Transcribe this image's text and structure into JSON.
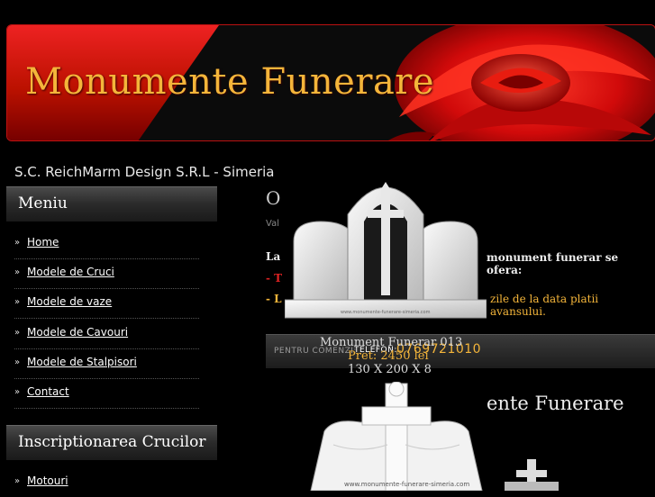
{
  "header": {
    "title": "Monumente Funerare"
  },
  "subtitle": "S.C. ReichMarm Design S.R.L - Simeria",
  "sidebar": {
    "menu_title": "Meniu",
    "items": [
      {
        "label": "Home"
      },
      {
        "label": "Modele de Cruci"
      },
      {
        "label": "Modele de vaze"
      },
      {
        "label": "Modele de Cavouri"
      },
      {
        "label": "Modele de Stalpisori"
      },
      {
        "label": "Contact"
      }
    ],
    "section2_title": "Inscriptionarea Crucilor",
    "section2_items": [
      {
        "label": "Motouri"
      }
    ]
  },
  "main": {
    "title_fragment": "O",
    "small_fragment": "Val",
    "la_fragment": "La",
    "offer_text": "monument funerar se ofera:",
    "dash_red": "- T",
    "dash_yellow": "- L",
    "days_text": "zile de la data platii avansului.",
    "order_label": "PENTRU COMENZI:",
    "phone_label": "TELEFON:",
    "phone_number": "0769721010",
    "title2_fragment": "ente Funerare"
  },
  "popup": {
    "name": "Monument Funerar 013",
    "price": "Pret: 2450 lei",
    "dimensions": "130 X 200 X 8",
    "image1_caption": "www.monumente-funerare-simeria.com",
    "image2_caption": "www.monumente-funerare-simeria.com"
  },
  "colors": {
    "accent": "#f4b53a",
    "banner_red": "#cc1111",
    "background": "#000000"
  }
}
